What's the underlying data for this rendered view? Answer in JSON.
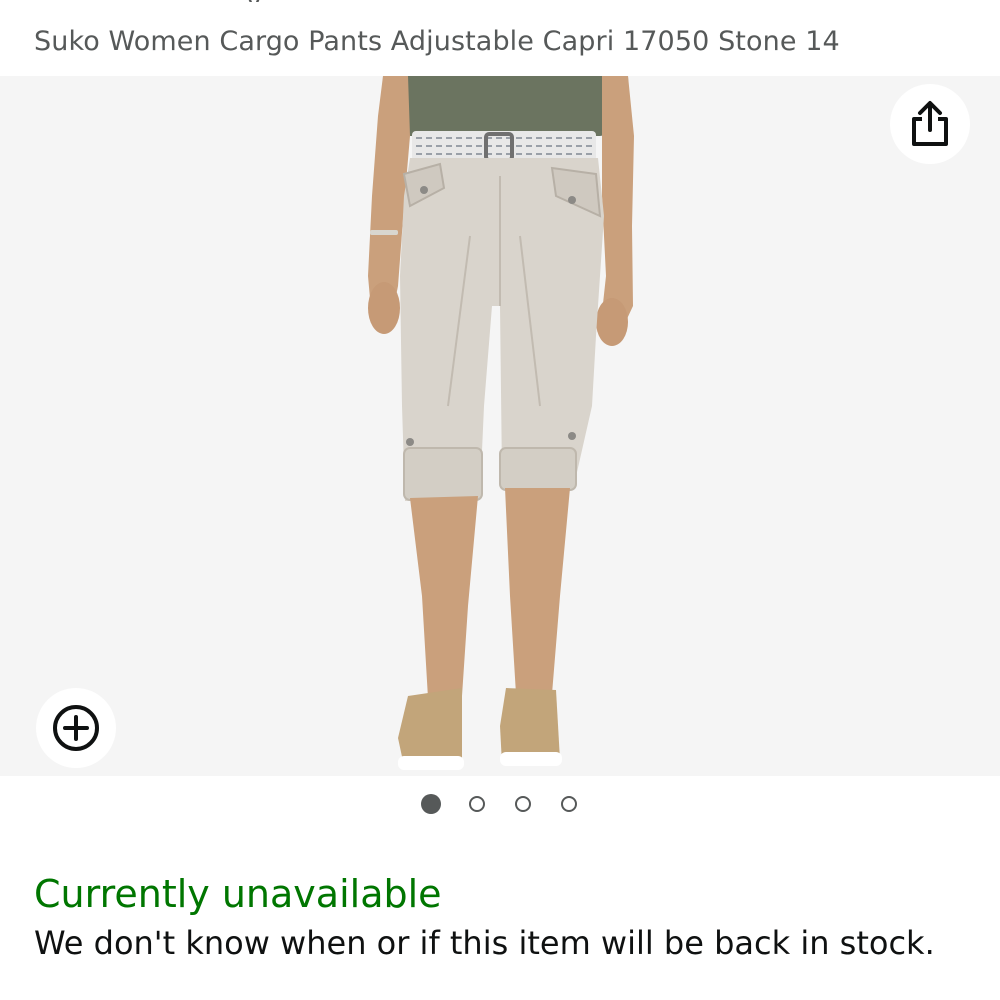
{
  "product": {
    "title": "Suko Women Cargo Pants Adjustable Capri 17050 Stone 14",
    "clipped_text": "y"
  },
  "gallery": {
    "image_alt": "Woman wearing stone colored cargo capri pants with belt and gold slip-on sneakers",
    "share_icon": "share-icon",
    "zoom_icon": "plus-circle-icon",
    "dots_total": 4,
    "active_dot": 1
  },
  "availability": {
    "status": "Currently unavailable",
    "message": "We don't know when or if this item will be back in stock."
  },
  "colors": {
    "availability_green": "#007600",
    "gallery_background": "#f5f5f5",
    "pants": "#d9d4cc",
    "shirt": "#6b7460",
    "skin": "#caa07c",
    "shoes": "#c2a57a"
  }
}
